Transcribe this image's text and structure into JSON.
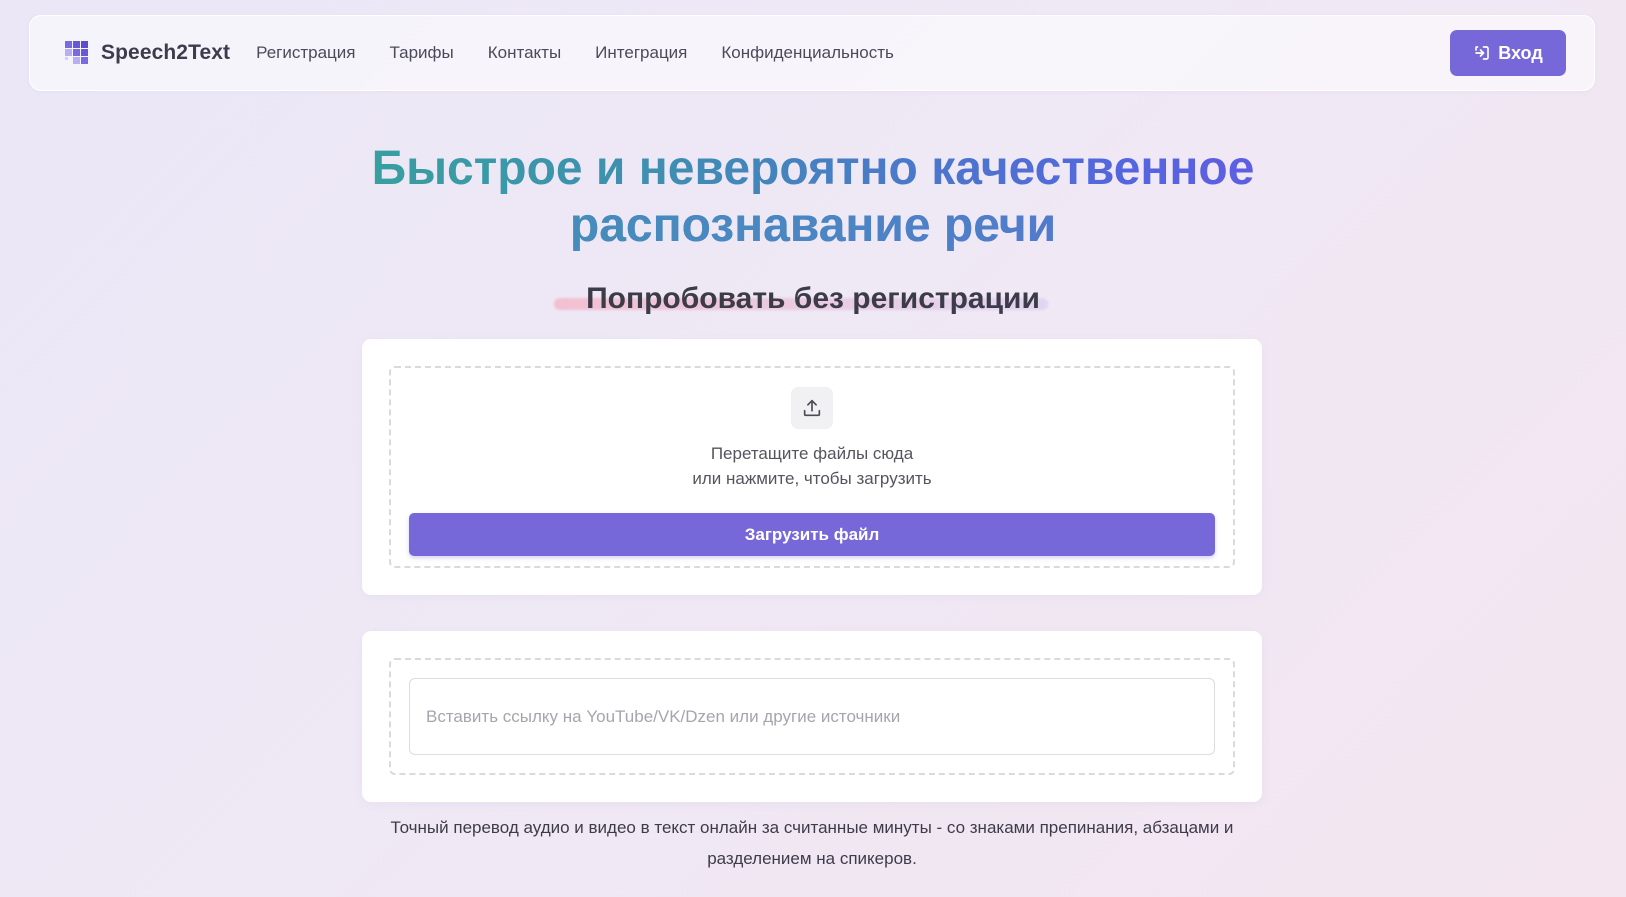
{
  "header": {
    "brand_name": "Speech2Text",
    "nav": [
      {
        "label": "Регистрация"
      },
      {
        "label": "Тарифы"
      },
      {
        "label": "Контакты"
      },
      {
        "label": "Интеграция"
      },
      {
        "label": "Конфиденциальность"
      }
    ],
    "login_label": "Вход"
  },
  "hero": {
    "title_line1": "Быстрое и невероятно качественное",
    "title_line2": "распознавание речи",
    "subtitle": "Попробовать без регистрации"
  },
  "upload": {
    "drop_text_line1": "Перетащите файлы сюда",
    "drop_text_line2": "или нажмите, чтобы загрузить",
    "button_label": "Загрузить файл"
  },
  "link": {
    "placeholder": "Вставить ссылку на YouTube/VK/Dzen или другие источники"
  },
  "description": "Точный перевод аудио и видео в текст онлайн за считанные минуты - со знаками препинания, абзацами и разделением на спикеров.",
  "colors": {
    "accent": "#7668d9",
    "gradient_start": "#2fb58c",
    "gradient_end": "#7a4ce6"
  }
}
